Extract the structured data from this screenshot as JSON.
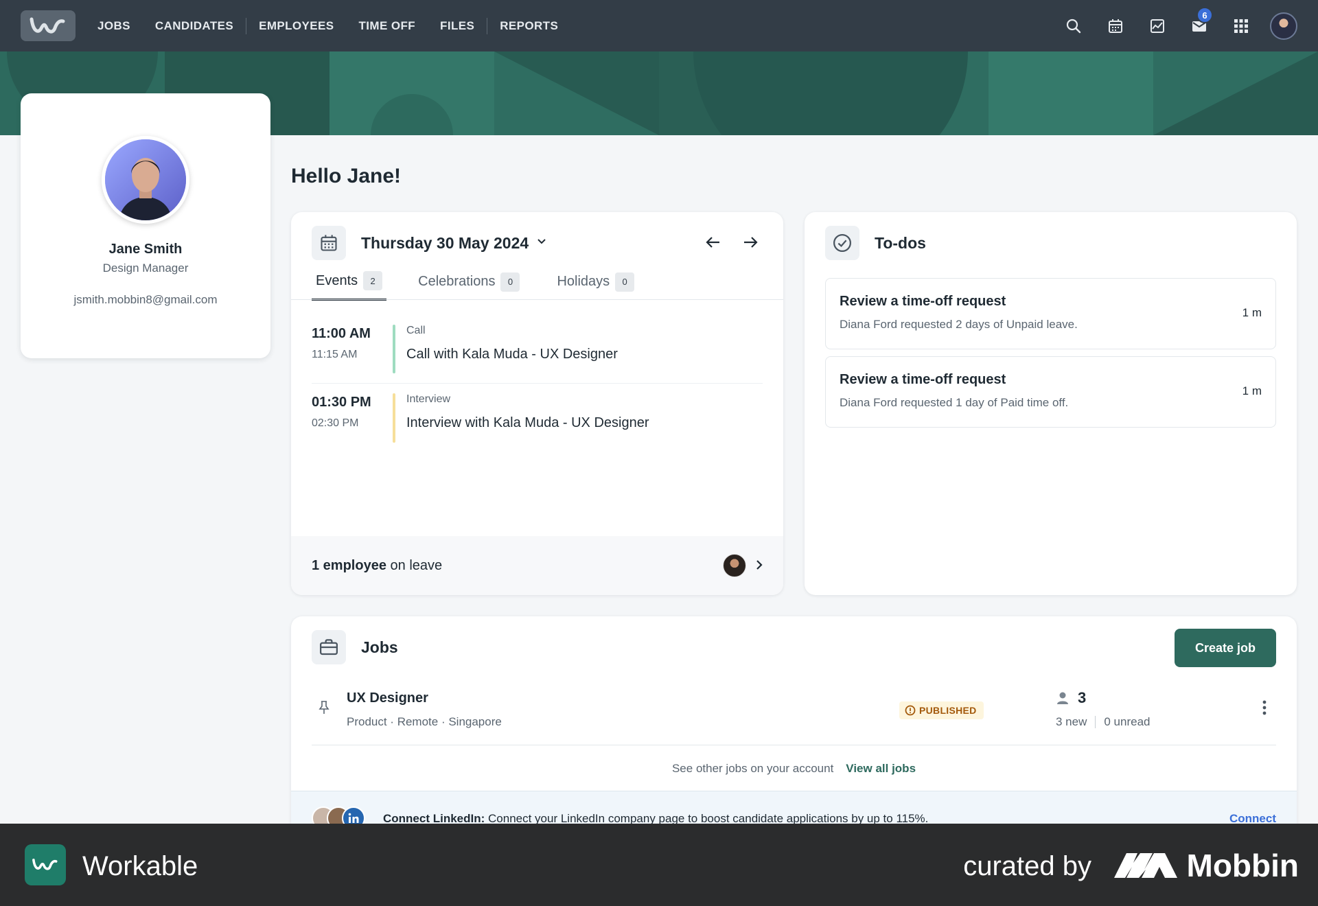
{
  "nav": {
    "links": [
      "JOBS",
      "CANDIDATES",
      "EMPLOYEES",
      "TIME OFF",
      "FILES",
      "REPORTS"
    ],
    "icons": [
      "search-icon",
      "calendar-icon",
      "analytics-icon",
      "mail-icon",
      "apps-grid-icon"
    ],
    "mail_badge": "6",
    "accent": "#333d47"
  },
  "profile": {
    "name": "Jane Smith",
    "role": "Design Manager",
    "email": "jsmith.mobbin8@gmail.com"
  },
  "greeting": "Hello Jane!",
  "calendar": {
    "date": "Thursday 30 May 2024",
    "tabs": [
      {
        "label": "Events",
        "count": "2"
      },
      {
        "label": "Celebrations",
        "count": "0"
      },
      {
        "label": "Holidays",
        "count": "0"
      }
    ],
    "events": [
      {
        "start": "11:00 AM",
        "end": "11:15 AM",
        "type": "Call",
        "title": "Call with Kala Muda - UX Designer",
        "color": "#9fdcc0"
      },
      {
        "start": "01:30 PM",
        "end": "02:30 PM",
        "type": "Interview",
        "title": "Interview with Kala Muda - UX Designer",
        "color": "#f6df9a"
      }
    ],
    "leave_bold": "1 employee",
    "leave_rest": " on leave"
  },
  "todos": {
    "title": "To-dos",
    "items": [
      {
        "title": "Review a time-off request",
        "desc": "Diana Ford requested 2 days of Unpaid leave.",
        "age": "1 m"
      },
      {
        "title": "Review a time-off request",
        "desc": "Diana Ford requested 1 day of Paid time off.",
        "age": "1 m"
      }
    ]
  },
  "jobs": {
    "title": "Jobs",
    "create_label": "Create job",
    "row": {
      "name": "UX Designer",
      "meta": "Product · Remote · Singapore",
      "status": "PUBLISHED",
      "candidates": "3",
      "new": "3 new",
      "unread": "0 unread"
    },
    "other_text": "See other jobs on your account",
    "view_all": "View all jobs",
    "linkedin_bold": "Connect LinkedIn:",
    "linkedin_text": " Connect your LinkedIn company page to boost candidate applications by up to 115%.",
    "linkedin_action": "Connect"
  },
  "branding": {
    "app": "Workable",
    "curated": "curated by",
    "mobbin": "Mobbin"
  }
}
